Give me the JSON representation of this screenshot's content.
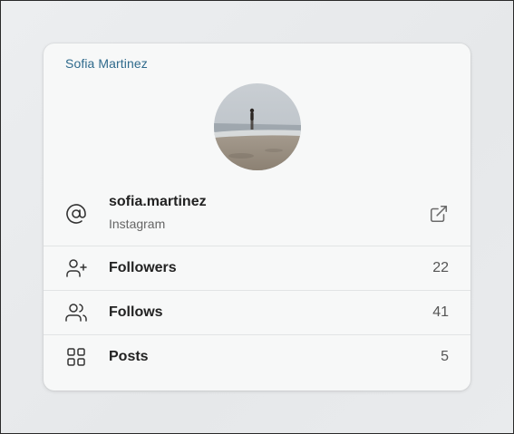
{
  "card": {
    "title": "Sofia Martinez"
  },
  "account": {
    "handle": "sofia.martinez",
    "platform": "Instagram",
    "icon": "at-sign-icon",
    "action_icon": "open-external-icon"
  },
  "stats": [
    {
      "label": "Followers",
      "value": "22",
      "icon": "user-plus-icon"
    },
    {
      "label": "Follows",
      "value": "41",
      "icon": "users-icon"
    },
    {
      "label": "Posts",
      "value": "5",
      "icon": "grid-icon"
    }
  ],
  "colors": {
    "title": "#2f6a8c",
    "card_bg": "#f7f8f8",
    "page_bg": "#e8e9eb"
  }
}
